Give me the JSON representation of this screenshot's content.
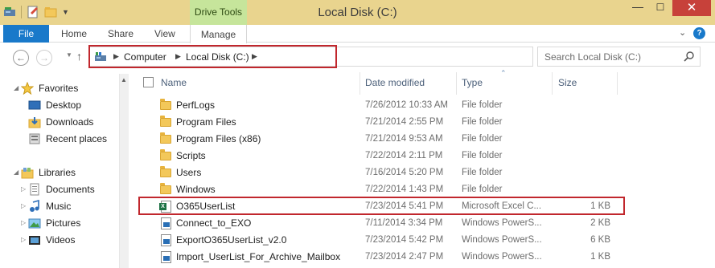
{
  "window": {
    "title": "Local Disk (C:)",
    "contextual_tab": "Drive Tools"
  },
  "controls": {
    "minimize": "—",
    "maximize": "☐",
    "close": "✕"
  },
  "ribbon": {
    "tabs": [
      "File",
      "Home",
      "Share",
      "View",
      "Manage"
    ],
    "help": "?"
  },
  "address": {
    "breadcrumb": [
      "Computer",
      "Local Disk (C:)"
    ],
    "search_placeholder": "Search Local Disk (C:)"
  },
  "navpane": {
    "favorites_label": "Favorites",
    "favorites": [
      "Desktop",
      "Downloads",
      "Recent places"
    ],
    "libraries_label": "Libraries",
    "libraries": [
      "Documents",
      "Music",
      "Pictures",
      "Videos"
    ]
  },
  "columns": {
    "name": "Name",
    "date": "Date modified",
    "type": "Type",
    "size": "Size"
  },
  "files": [
    {
      "name": "PerfLogs",
      "date": "7/26/2012 10:33 AM",
      "type": "File folder",
      "size": "",
      "icon": "folder-icon"
    },
    {
      "name": "Program Files",
      "date": "7/21/2014 2:55 PM",
      "type": "File folder",
      "size": "",
      "icon": "folder-icon"
    },
    {
      "name": "Program Files (x86)",
      "date": "7/21/2014 9:53 AM",
      "type": "File folder",
      "size": "",
      "icon": "folder-icon"
    },
    {
      "name": "Scripts",
      "date": "7/22/2014 2:11 PM",
      "type": "File folder",
      "size": "",
      "icon": "folder-icon"
    },
    {
      "name": "Users",
      "date": "7/16/2014 5:20 PM",
      "type": "File folder",
      "size": "",
      "icon": "folder-icon"
    },
    {
      "name": "Windows",
      "date": "7/22/2014 1:43 PM",
      "type": "File folder",
      "size": "",
      "icon": "folder-icon"
    },
    {
      "name": "O365UserList",
      "date": "7/23/2014 5:41 PM",
      "type": "Microsoft Excel C...",
      "size": "1 KB",
      "icon": "excel-csv-icon"
    },
    {
      "name": "Connect_to_EXO",
      "date": "7/11/2014 3:34 PM",
      "type": "Windows PowerS...",
      "size": "2 KB",
      "icon": "powershell-script-icon"
    },
    {
      "name": "ExportO365UserList_v2.0",
      "date": "7/23/2014 5:42 PM",
      "type": "Windows PowerS...",
      "size": "6 KB",
      "icon": "powershell-script-icon"
    },
    {
      "name": "Import_UserList_For_Archive_Mailbox",
      "date": "7/23/2014 2:47 PM",
      "type": "Windows PowerS...",
      "size": "1 KB",
      "icon": "powershell-script-icon"
    }
  ]
}
